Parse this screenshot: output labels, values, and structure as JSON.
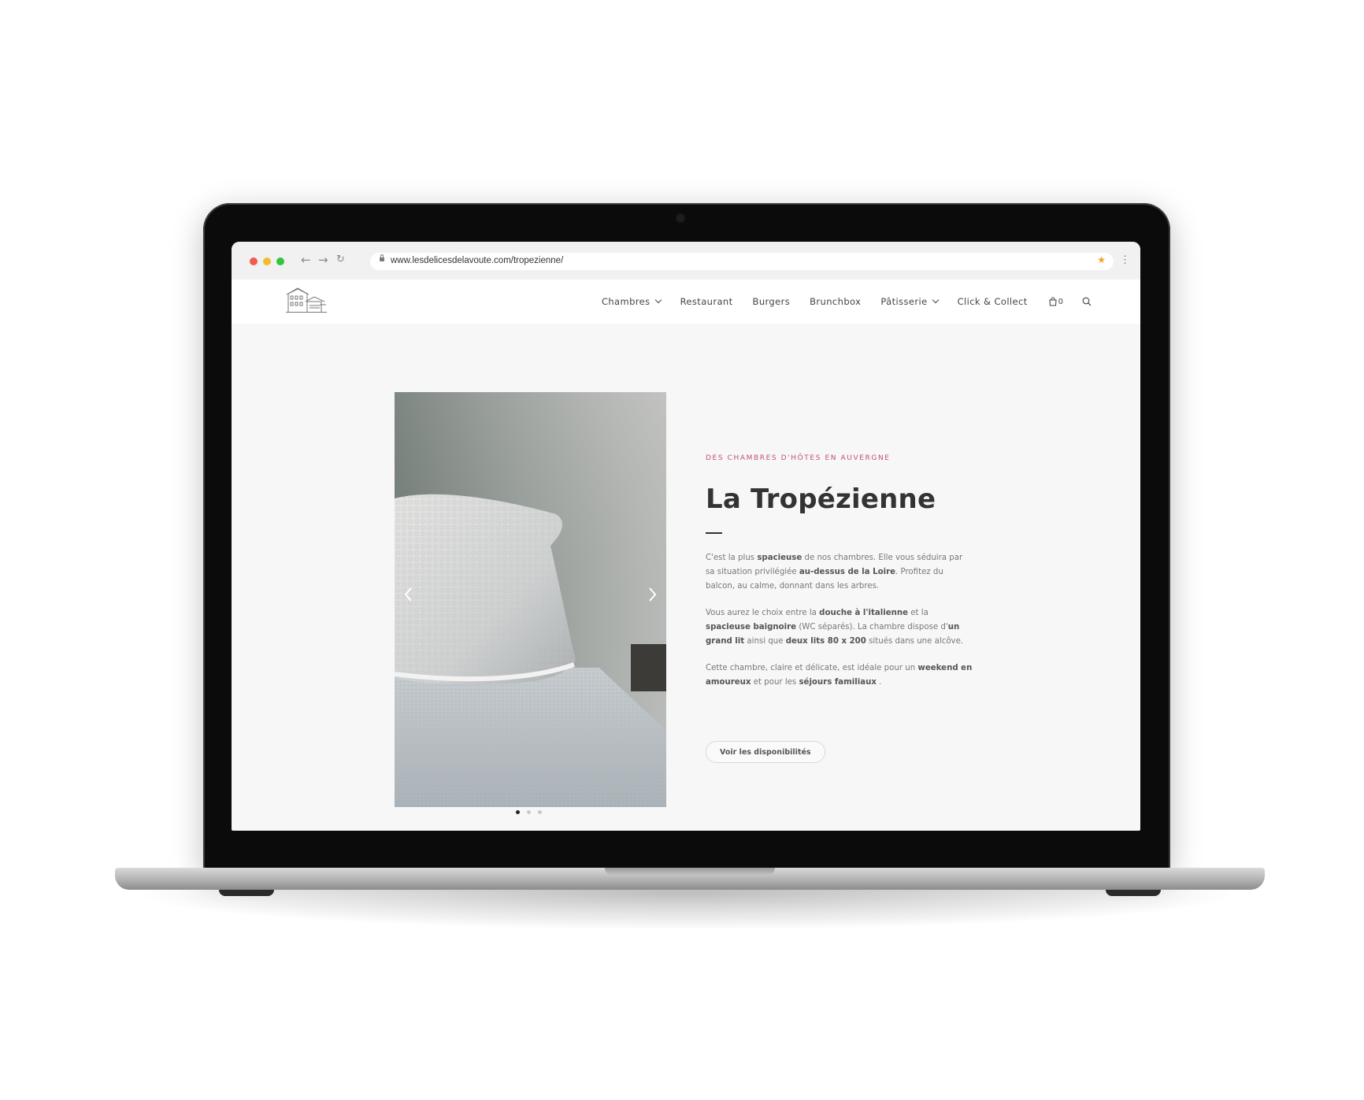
{
  "browser": {
    "url": "www.lesdelicesdelavoute.com/tropezienne/",
    "back_glyph": "←",
    "forward_glyph": "→",
    "reload_glyph": "↻",
    "bookmark_glyph": "★",
    "menu_glyph": "⋮",
    "colors": {
      "close": "#ee5b53",
      "minimize": "#f5bb2e",
      "maximize": "#33c440",
      "bookmark": "#f2a21b"
    }
  },
  "nav": {
    "items": [
      {
        "label": "Chambres",
        "dropdown": true
      },
      {
        "label": "Restaurant",
        "dropdown": false
      },
      {
        "label": "Burgers",
        "dropdown": false
      },
      {
        "label": "Brunchbox",
        "dropdown": false
      },
      {
        "label": "Pâtisserie",
        "dropdown": true
      },
      {
        "label": "Click & Collect",
        "dropdown": false
      }
    ],
    "cart_count": "0",
    "icons": [
      "cart-icon",
      "search-icon"
    ]
  },
  "hero": {
    "eyebrow": "DES CHAMBRES D'HÔTES EN AUVERGNE",
    "title": "La Tropézienne",
    "paragraphs": [
      [
        {
          "t": "C'est la plus "
        },
        {
          "t": "spacieuse",
          "b": true
        },
        {
          "t": " de nos chambres. Elle vous séduira par sa situation privilégiée "
        },
        {
          "t": "au-dessus de la Loire",
          "b": true
        },
        {
          "t": ". Profitez du balcon, au calme, donnant dans les arbres."
        }
      ],
      [
        {
          "t": "Vous aurez le choix entre la "
        },
        {
          "t": "douche à l'italienne",
          "b": true
        },
        {
          "t": " et la "
        },
        {
          "t": "spacieuse baignoire",
          "b": true
        },
        {
          "t": " (WC séparés). La chambre dispose d'"
        },
        {
          "t": "un grand lit",
          "b": true
        },
        {
          "t": " ainsi que "
        },
        {
          "t": "deux lits 80 x 200",
          "b": true
        },
        {
          "t": " situés dans une alcôve."
        }
      ],
      [
        {
          "t": "Cette chambre, claire et délicate, est idéale pour un "
        },
        {
          "t": "weekend en amoureux",
          "b": true
        },
        {
          "t": " et pour les "
        },
        {
          "t": "séjours familiaux",
          "b": true
        },
        {
          "t": " ."
        }
      ]
    ],
    "cta_label": "Voir les disponibilités",
    "accent_color": "#c0506d"
  },
  "carousel": {
    "slide_count": 3,
    "active_index": 0,
    "image": "photo of a white quilted pillow on a textured bedspread"
  }
}
